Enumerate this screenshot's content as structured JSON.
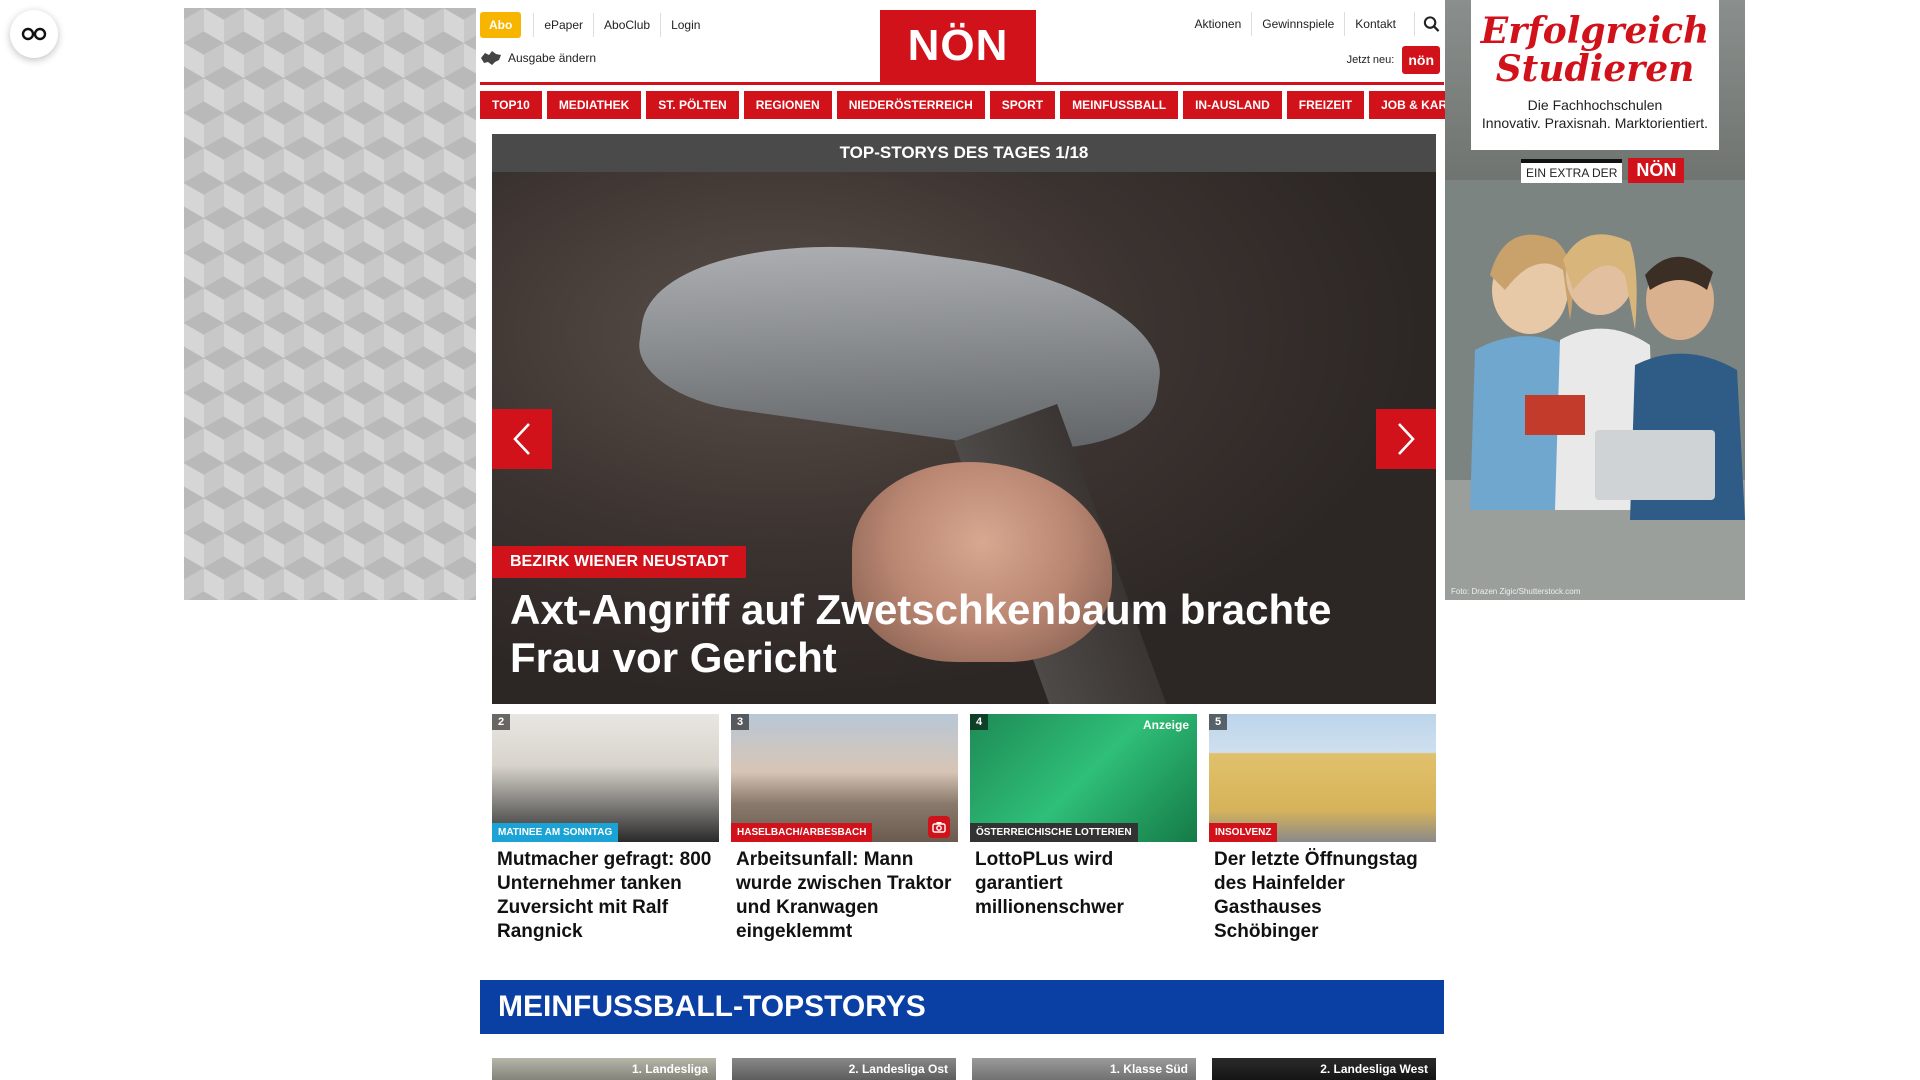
{
  "header": {
    "abo": "Abo",
    "top_links": [
      "ePaper",
      "AboClub",
      "Login"
    ],
    "ausgabe": "Ausgabe ändern",
    "logo": "NÖN",
    "right_links": [
      "Aktionen",
      "Gewinnspiele",
      "Kontakt"
    ],
    "jetzt_neu": "Jetzt neu:",
    "jetzt_logo": "nön"
  },
  "nav": [
    "TOP10",
    "MEDIATHEK",
    "ST. PÖLTEN",
    "REGIONEN",
    "NIEDERÖSTERREICH",
    "SPORT",
    "MEINFUSSBALL",
    "IN-AUSLAND",
    "FREIZEIT",
    "JOB & KARRIERE"
  ],
  "hero": {
    "counter": "TOP-STORYS DES TAGES 1/18",
    "category": "BEZIRK WIENER NEUSTADT",
    "title": "Axt-Angriff auf Zwetschkenbaum brachte Frau vor Gericht"
  },
  "stories": [
    {
      "num": "2",
      "tag": "MATINEE AM SONNTAG",
      "title": "Mutmacher gefragt: 800 Unternehmer tanken Zuversicht mit Ralf Rangnick"
    },
    {
      "num": "3",
      "tag": "HASELBACH/ARBESBACH",
      "title": "Arbeitsunfall: Mann wurde zwischen Traktor und Kranwagen eingeklemmt"
    },
    {
      "num": "4",
      "tag": "ÖSTERREICHISCHE LOTTERIEN",
      "ad": "Anzeige",
      "title": "LottoPLus wird garantiert millionenschwer"
    },
    {
      "num": "5",
      "tag": "INSOLVENZ",
      "title": "Der letzte Öffnungstag des Hainfelder Gasthauses Schöbinger"
    }
  ],
  "section": {
    "title": "MEINFUSSBALL-TOPSTORYS",
    "labels": [
      "1. Landesliga",
      "2. Landesliga Ost",
      "1. Klasse Süd",
      "2. Landesliga West"
    ]
  },
  "right_ad": {
    "title_line1": "Erfolgreich",
    "title_line2": "Studieren",
    "sub_line1": "Die Fachhochschulen",
    "sub_line2": "Innovativ. Praxisnah. Marktorientiert.",
    "extra": "EIN EXTRA DER",
    "extra_logo": "NÖN",
    "credit": "Foto: Drazen Zigic/Shutterstock.com"
  }
}
